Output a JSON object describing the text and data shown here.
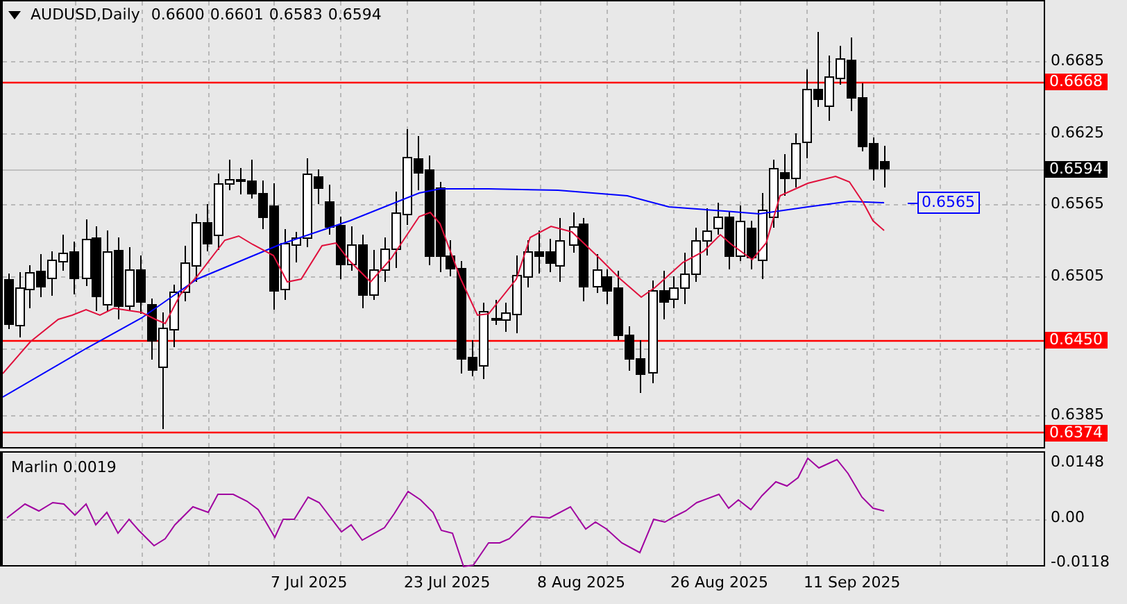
{
  "header": {
    "symbol": "AUDUSD,Daily",
    "ohlc": [
      "0.6600",
      "0.6601",
      "0.6583",
      "0.6594"
    ]
  },
  "price_axis": {
    "ticks": [
      "0.6685",
      "0.6625",
      "0.6565",
      "0.6505",
      "0.6385"
    ]
  },
  "levels": [
    {
      "label": "0.6668"
    },
    {
      "label": "0.6450"
    },
    {
      "label": "0.6374"
    }
  ],
  "current_price": "0.6594",
  "moving_average_label": "0.6565",
  "indicator": {
    "name": "Marlin 0.0019",
    "ticks": [
      "0.0148",
      "0.00",
      "-0.0118"
    ]
  },
  "dates": [
    "7 Jul 2025",
    "23 Jul 2025",
    "8 Aug 2025",
    "26 Aug 2025",
    "11 Sep 2025"
  ]
}
